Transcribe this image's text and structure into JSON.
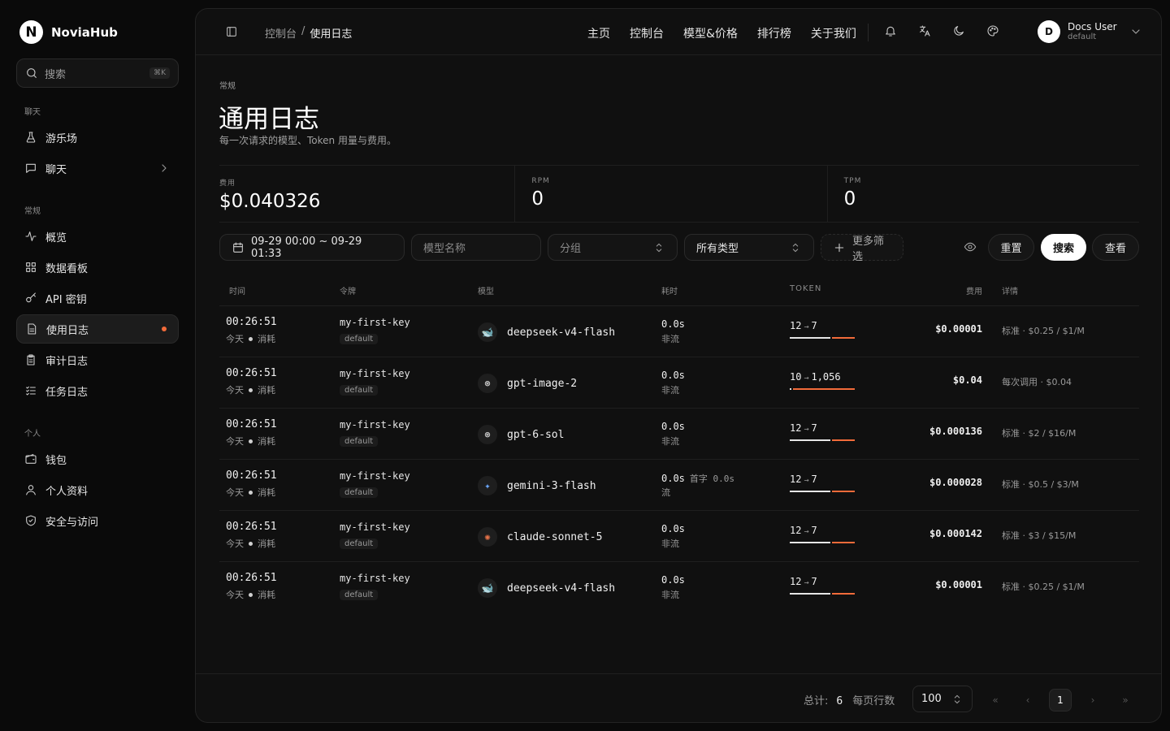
{
  "brand": {
    "logo_letter": "N",
    "name": "NoviaHub"
  },
  "sidebar": {
    "search_placeholder": "搜索",
    "search_kbd": "⌘K",
    "sections": {
      "chat": "聊天",
      "general": "常规",
      "personal": "个人"
    },
    "items": {
      "playground": "游乐场",
      "chat": "聊天",
      "overview": "概览",
      "dashboard": "数据看板",
      "api_keys": "API 密钥",
      "usage_logs": "使用日志",
      "audit_logs": "审计日志",
      "task_logs": "任务日志",
      "wallet": "钱包",
      "profile": "个人资料",
      "security": "安全与访问"
    }
  },
  "topbar": {
    "breadcrumb": [
      "控制台",
      "/",
      "使用日志"
    ],
    "nav": [
      "主页",
      "控制台",
      "模型&价格",
      "排行榜",
      "关于我们"
    ],
    "user": {
      "initial": "D",
      "name": "Docs User",
      "role": "default"
    }
  },
  "page": {
    "eyebrow": "常规",
    "title": "通用日志",
    "subtitle": "每一次请求的模型、Token 用量与费用。"
  },
  "stats": [
    {
      "label": "费用",
      "value": "$0.040326"
    },
    {
      "label": "RPM",
      "value": "0"
    },
    {
      "label": "TPM",
      "value": "0"
    }
  ],
  "filters": {
    "date_range": "09-29 00:00 ~ 09-29 01:33",
    "model_placeholder": "模型名称",
    "group": "分组",
    "type": "所有类型",
    "more": "更多筛选",
    "reset": "重置",
    "search": "搜索",
    "view": "查看"
  },
  "table": {
    "headers": [
      "时间",
      "令牌",
      "模型",
      "耗时",
      "TOKEN",
      "费用",
      "详情"
    ],
    "rows": [
      {
        "time": "00:26:51",
        "day": "今天",
        "kind": "消耗",
        "key": "my-first-key",
        "group": "default",
        "model": "deepseek-v4-flash",
        "model_icon": "🐋",
        "latency": "0.0s",
        "first_token": "",
        "stream": "非流",
        "tok_in": "12",
        "tok_out": "7",
        "in_ratio": 0.63,
        "cost": "$0.00001",
        "detail": "标准 · $0.25 / $1/M"
      },
      {
        "time": "00:26:51",
        "day": "今天",
        "kind": "消耗",
        "key": "my-first-key",
        "group": "default",
        "model": "gpt-image-2",
        "model_icon": "⊛",
        "latency": "0.0s",
        "first_token": "",
        "stream": "非流",
        "tok_in": "10",
        "tok_out": "1,056",
        "in_ratio": 0.01,
        "cost": "$0.04",
        "detail": "每次调用 · $0.04"
      },
      {
        "time": "00:26:51",
        "day": "今天",
        "kind": "消耗",
        "key": "my-first-key",
        "group": "default",
        "model": "gpt-6-sol",
        "model_icon": "⊛",
        "latency": "0.0s",
        "first_token": "",
        "stream": "非流",
        "tok_in": "12",
        "tok_out": "7",
        "in_ratio": 0.63,
        "cost": "$0.000136",
        "detail": "标准 · $2 / $16/M"
      },
      {
        "time": "00:26:51",
        "day": "今天",
        "kind": "消耗",
        "key": "my-first-key",
        "group": "default",
        "model": "gemini-3-flash",
        "model_icon": "✦",
        "latency": "0.0s",
        "first_token": "首字 0.0s",
        "stream": "流",
        "tok_in": "12",
        "tok_out": "7",
        "in_ratio": 0.63,
        "cost": "$0.000028",
        "detail": "标准 · $0.5 / $3/M"
      },
      {
        "time": "00:26:51",
        "day": "今天",
        "kind": "消耗",
        "key": "my-first-key",
        "group": "default",
        "model": "claude-sonnet-5",
        "model_icon": "✺",
        "latency": "0.0s",
        "first_token": "",
        "stream": "非流",
        "tok_in": "12",
        "tok_out": "7",
        "in_ratio": 0.63,
        "cost": "$0.000142",
        "detail": "标准 · $3 / $15/M"
      },
      {
        "time": "00:26:51",
        "day": "今天",
        "kind": "消耗",
        "key": "my-first-key",
        "group": "default",
        "model": "deepseek-v4-flash",
        "model_icon": "🐋",
        "latency": "0.0s",
        "first_token": "",
        "stream": "非流",
        "tok_in": "12",
        "tok_out": "7",
        "in_ratio": 0.63,
        "cost": "$0.00001",
        "detail": "标准 · $0.25 / $1/M"
      }
    ]
  },
  "footer": {
    "total_label": "总计:",
    "total": "6",
    "per_page_label": "每页行数",
    "per_page": "100",
    "current_page": "1"
  },
  "colors": {
    "accent": "#f26b3a",
    "background": "#0a0a0a",
    "panel": "#101010"
  }
}
